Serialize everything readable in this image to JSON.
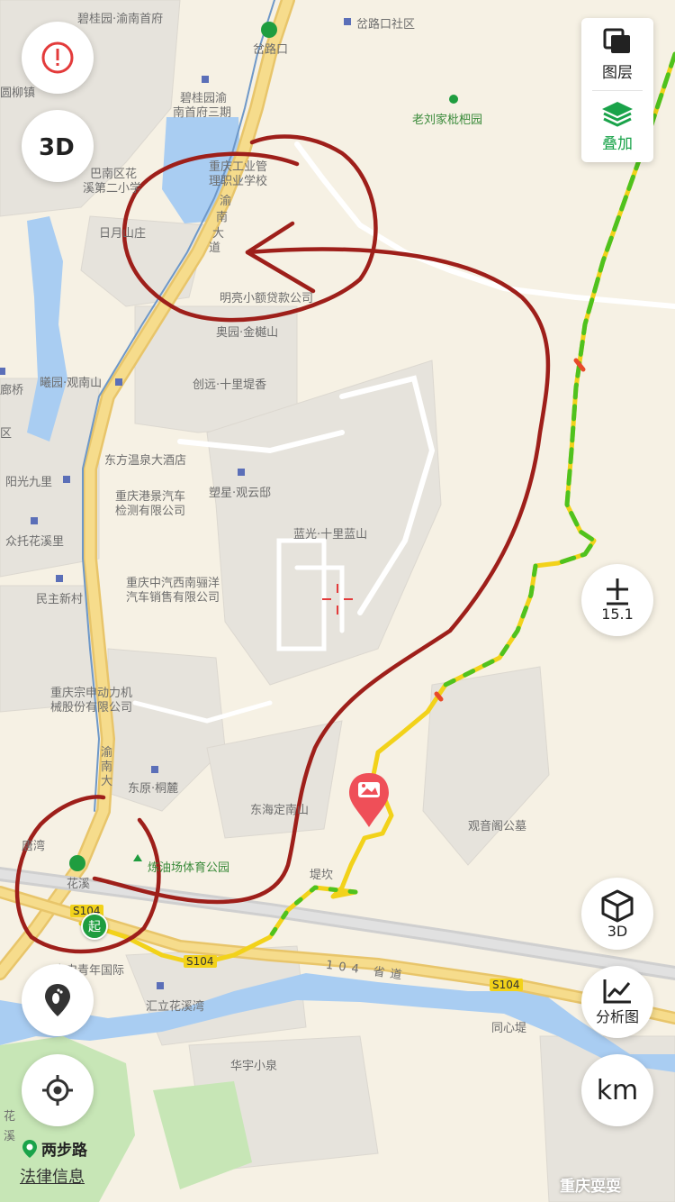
{
  "map": {
    "places": [
      {
        "id": "p1",
        "text": "碧桂园·渝南首府"
      },
      {
        "id": "p2",
        "text": "岔路口"
      },
      {
        "id": "p3",
        "text": "岔路口社区"
      },
      {
        "id": "p4",
        "text": "碧桂园渝"
      },
      {
        "id": "p5",
        "text": "南首府三期"
      },
      {
        "id": "p6",
        "text": "老刘家枇杷园"
      },
      {
        "id": "p7",
        "text": "圆柳镇"
      },
      {
        "id": "p8",
        "text": "巴南区花"
      },
      {
        "id": "p9",
        "text": "溪第二小学"
      },
      {
        "id": "p10",
        "text": "重庆工业管"
      },
      {
        "id": "p11",
        "text": "理职业学校"
      },
      {
        "id": "p12",
        "text": "日月山庄"
      },
      {
        "id": "p13",
        "text": "渝"
      },
      {
        "id": "p14",
        "text": "南"
      },
      {
        "id": "p15",
        "text": "大"
      },
      {
        "id": "p16",
        "text": "道"
      },
      {
        "id": "p17",
        "text": "明亮小额贷款公司"
      },
      {
        "id": "p18",
        "text": "奥园·金樾山"
      },
      {
        "id": "p19",
        "text": "曦园·观南山"
      },
      {
        "id": "p20",
        "text": "创远·十里堤香"
      },
      {
        "id": "p21",
        "text": "廊桥"
      },
      {
        "id": "p22",
        "text": "区"
      },
      {
        "id": "p23",
        "text": "东方温泉大酒店"
      },
      {
        "id": "p24",
        "text": "阳光九里"
      },
      {
        "id": "p25",
        "text": "塑星·观云邸"
      },
      {
        "id": "p26",
        "text": "重庆港景汽车"
      },
      {
        "id": "p27",
        "text": "检测有限公司"
      },
      {
        "id": "p28",
        "text": "众托花溪里"
      },
      {
        "id": "p29",
        "text": "蓝光·十里蓝山"
      },
      {
        "id": "p30",
        "text": "重庆中汽西南骊洋"
      },
      {
        "id": "p31",
        "text": "汽车销售有限公司"
      },
      {
        "id": "p32",
        "text": "民主新村"
      },
      {
        "id": "p33",
        "text": "重庆宗申动力机"
      },
      {
        "id": "p34",
        "text": "械股份有限公司"
      },
      {
        "id": "p35",
        "text": "渝"
      },
      {
        "id": "p36",
        "text": "南"
      },
      {
        "id": "p37",
        "text": "大"
      },
      {
        "id": "p38",
        "text": "东原·桐麓"
      },
      {
        "id": "p39",
        "text": "东海定南山"
      },
      {
        "id": "p40",
        "text": "观音阁公墓"
      },
      {
        "id": "p41",
        "text": "唐湾"
      },
      {
        "id": "p42",
        "text": "炼油场体育公园"
      },
      {
        "id": "p43",
        "text": "堤坎"
      },
      {
        "id": "p44",
        "text": "花溪"
      },
      {
        "id": "p45",
        "text": "S104"
      },
      {
        "id": "p46",
        "text": "宗申青年国际"
      },
      {
        "id": "p47",
        "text": "S104"
      },
      {
        "id": "p48",
        "text": "104 省道"
      },
      {
        "id": "p49",
        "text": "S104"
      },
      {
        "id": "p50",
        "text": "汇立花溪湾"
      },
      {
        "id": "p51",
        "text": "同心堤"
      },
      {
        "id": "p52",
        "text": "华宇小泉"
      },
      {
        "id": "p53",
        "text": "溪"
      },
      {
        "id": "p54",
        "text": "花"
      }
    ]
  },
  "controls": {
    "layers_label": "图层",
    "overlay_label": "叠加",
    "zoom_level": "15.1",
    "three_d_label": "3D",
    "analysis_label": "分析图",
    "unit_label": "km",
    "start_marker": "起"
  },
  "footer": {
    "brand": "两步路",
    "legal": "法律信息",
    "watermark": "重庆耍耍"
  },
  "colors": {
    "track_green": "#4fc21e",
    "track_yellow": "#f2d21a",
    "annotation_red": "#9e1f1a",
    "accent_green": "#1aa34a",
    "alert_red": "#e33b3b"
  }
}
